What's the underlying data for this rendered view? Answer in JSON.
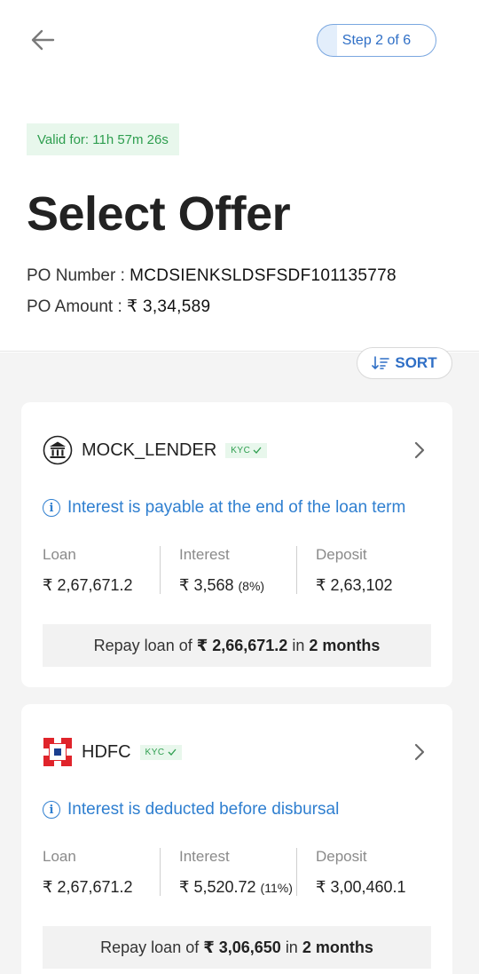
{
  "header": {
    "step": "Step 2 of 6",
    "valid_for": "Valid for: 11h 57m 26s",
    "title": "Select Offer",
    "po_number_label": "PO Number :",
    "po_number": "MCDSIENKSLDSFSDF101135778",
    "po_amount_label": "PO Amount :",
    "po_amount": "₹ 3,34,589"
  },
  "sort": {
    "label": "SORT",
    "icon": "sort-icon"
  },
  "offers": [
    {
      "lender": "MOCK_LENDER",
      "logo": "bank-icon",
      "kyc": "KYC",
      "info": "Interest is payable at the end of the loan term",
      "loan_label": "Loan",
      "loan": "₹ 2,67,671.2",
      "interest_label": "Interest",
      "interest": "₹ 3,568",
      "interest_rate": "(8%)",
      "deposit_label": "Deposit",
      "deposit": "₹ 2,63,102",
      "repay_prefix": "Repay loan of",
      "repay_amount": "₹ 2,66,671.2",
      "repay_in": "in",
      "repay_term": "2 months"
    },
    {
      "lender": "HDFC",
      "logo": "hdfc-logo-icon",
      "kyc": "KYC",
      "info": "Interest is deducted before disbursal",
      "loan_label": "Loan",
      "loan": "₹ 2,67,671.2",
      "interest_label": "Interest",
      "interest": "₹ 5,520.72",
      "interest_rate": "(11%)",
      "deposit_label": "Deposit",
      "deposit": "₹ 3,00,460.1",
      "repay_prefix": "Repay loan of",
      "repay_amount": "₹ 3,06,650",
      "repay_in": "in",
      "repay_term": "2 months"
    }
  ],
  "colors": {
    "accent": "#2f6fc6",
    "info": "#2f7fd0",
    "success": "#2e9e4f",
    "hdfc_red": "#e0242b",
    "hdfc_blue": "#1b3f8f"
  }
}
